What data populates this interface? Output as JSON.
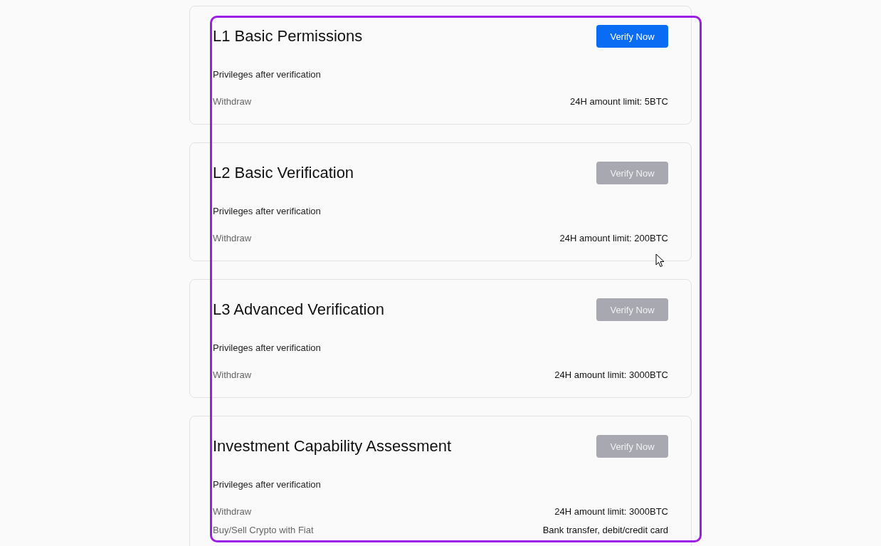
{
  "levels": [
    {
      "title": "L1 Basic Permissions",
      "button": {
        "label": "Verify Now",
        "disabled": false
      },
      "privileges_label": "Privileges after verification",
      "rows": [
        {
          "name": "Withdraw",
          "value": "24H amount limit: 5BTC"
        }
      ]
    },
    {
      "title": "L2 Basic Verification",
      "button": {
        "label": "Verify Now",
        "disabled": true
      },
      "privileges_label": "Privileges after verification",
      "rows": [
        {
          "name": "Withdraw",
          "value": "24H amount limit: 200BTC"
        }
      ]
    },
    {
      "title": "L3 Advanced Verification",
      "button": {
        "label": "Verify Now",
        "disabled": true
      },
      "privileges_label": "Privileges after verification",
      "rows": [
        {
          "name": "Withdraw",
          "value": "24H amount limit: 3000BTC"
        }
      ]
    },
    {
      "title": "Investment Capability Assessment",
      "button": {
        "label": "Verify Now",
        "disabled": true
      },
      "privileges_label": "Privileges after verification",
      "rows": [
        {
          "name": "Withdraw",
          "value": "24H amount limit: 3000BTC"
        },
        {
          "name": "Buy/Sell Crypto with Fiat",
          "value": "Bank transfer, debit/credit card"
        }
      ]
    }
  ]
}
